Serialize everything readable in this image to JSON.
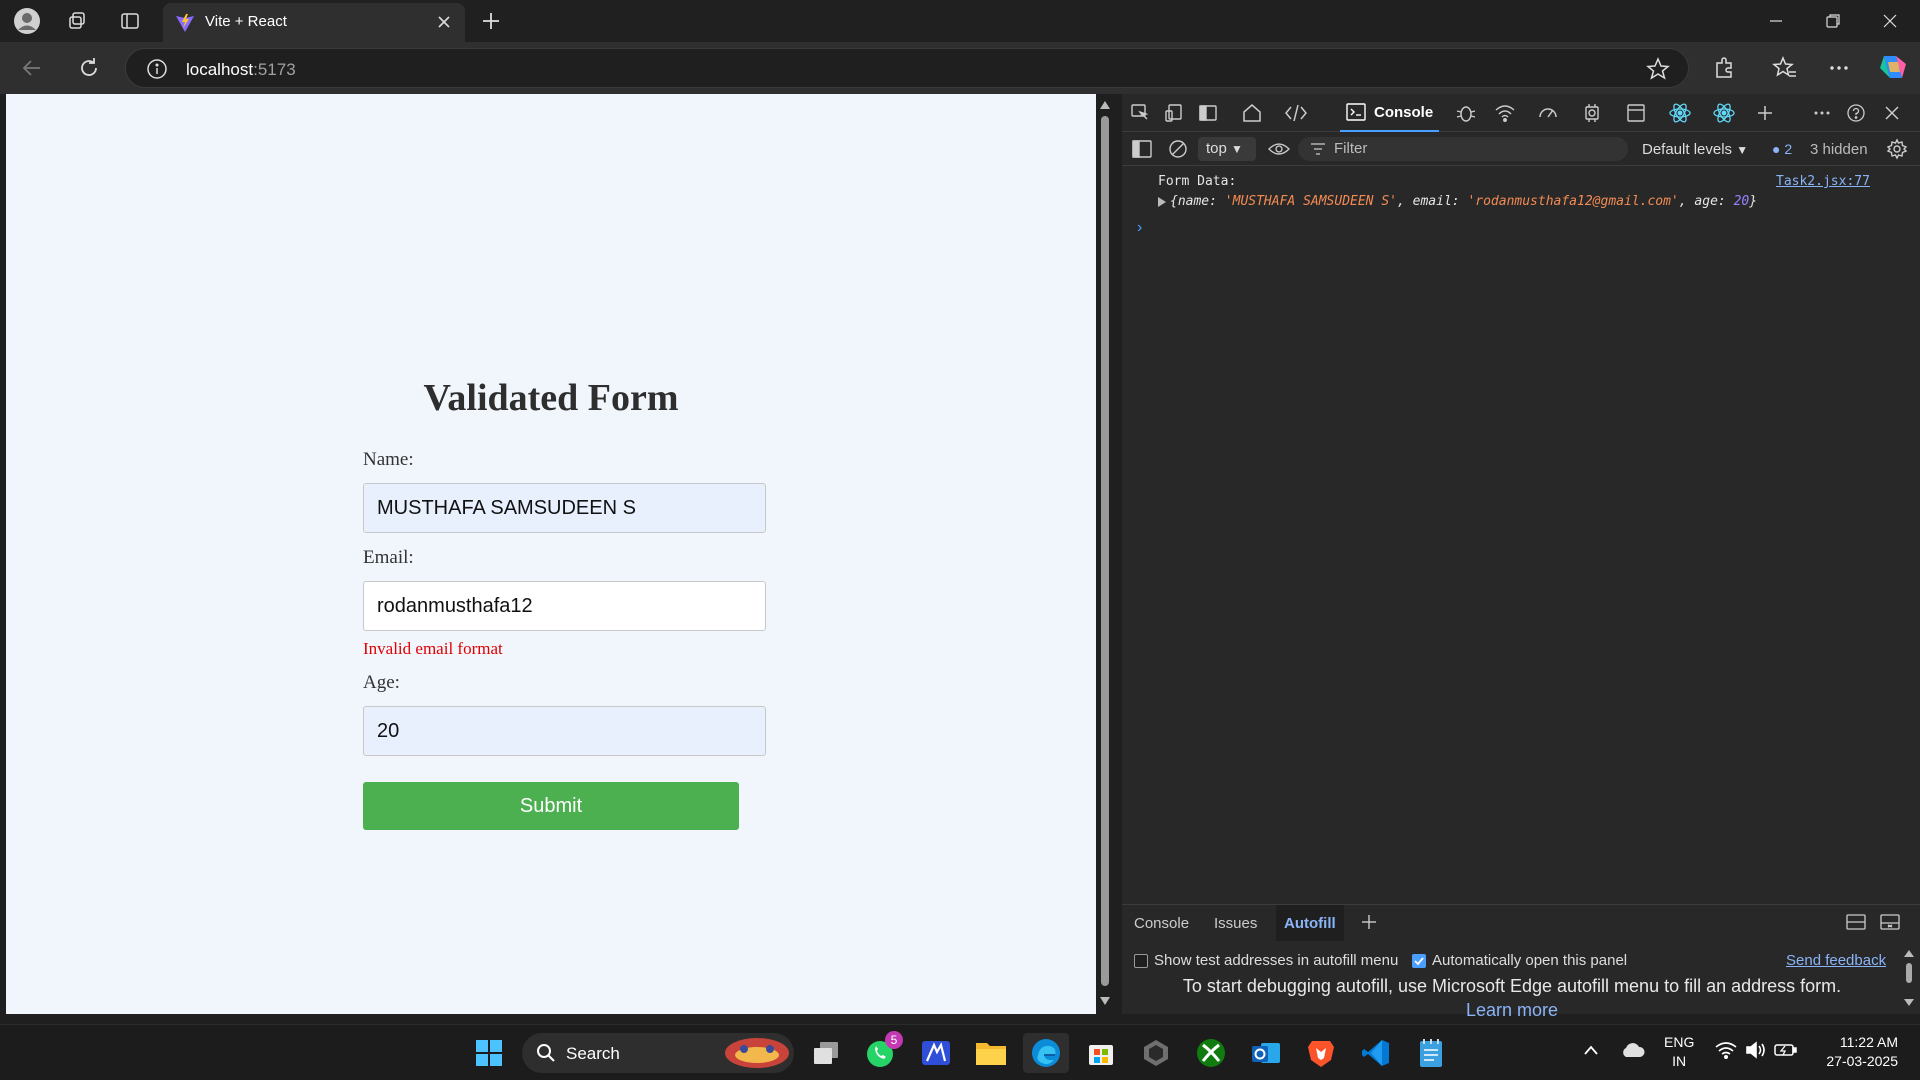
{
  "browser": {
    "tab_title": "Vite + React",
    "url_host": "localhost",
    "url_port": ":5173"
  },
  "page": {
    "title": "Validated Form",
    "fields": {
      "name_label": "Name:",
      "name_value": "MUSTHAFA SAMSUDEEN S",
      "email_label": "Email:",
      "email_value": "rodanmusthafa12",
      "email_error": "Invalid email format",
      "age_label": "Age:",
      "age_value": "20"
    },
    "submit_label": "Submit",
    "colors": {
      "submit_bg": "#4caf50",
      "error_text": "#e00000",
      "autofill_bg": "#e8f0fe"
    }
  },
  "devtools": {
    "console_tab": "Console",
    "context": "top",
    "filter_placeholder": "Filter",
    "levels": "Default levels",
    "issues_count": "2",
    "hidden_count": "3 hidden",
    "log": {
      "label": "Form Data:",
      "source": "Task2.jsx:77",
      "obj_open": "{name: ",
      "name_val": "'MUSTHAFA SAMSUDEEN S'",
      "email_key": ", email: ",
      "email_val": "'rodanmusthafa12@gmail.com'",
      "age_key": ", age: ",
      "age_val": "20",
      "obj_close": "}"
    },
    "drawer": {
      "tabs": [
        "Console",
        "Issues",
        "Autofill"
      ],
      "option_show_test": "Show test addresses in autofill menu",
      "option_auto_open": "Automatically open this panel",
      "feedback": "Send feedback",
      "message": "To start debugging autofill, use Microsoft Edge autofill menu to fill an address form.",
      "learn_more": "Learn more"
    }
  },
  "taskbar": {
    "search_label": "Search",
    "whatsapp_badge": "5",
    "lang_line1": "ENG",
    "lang_line2": "IN",
    "time": "11:22 AM",
    "date": "27-03-2025"
  }
}
